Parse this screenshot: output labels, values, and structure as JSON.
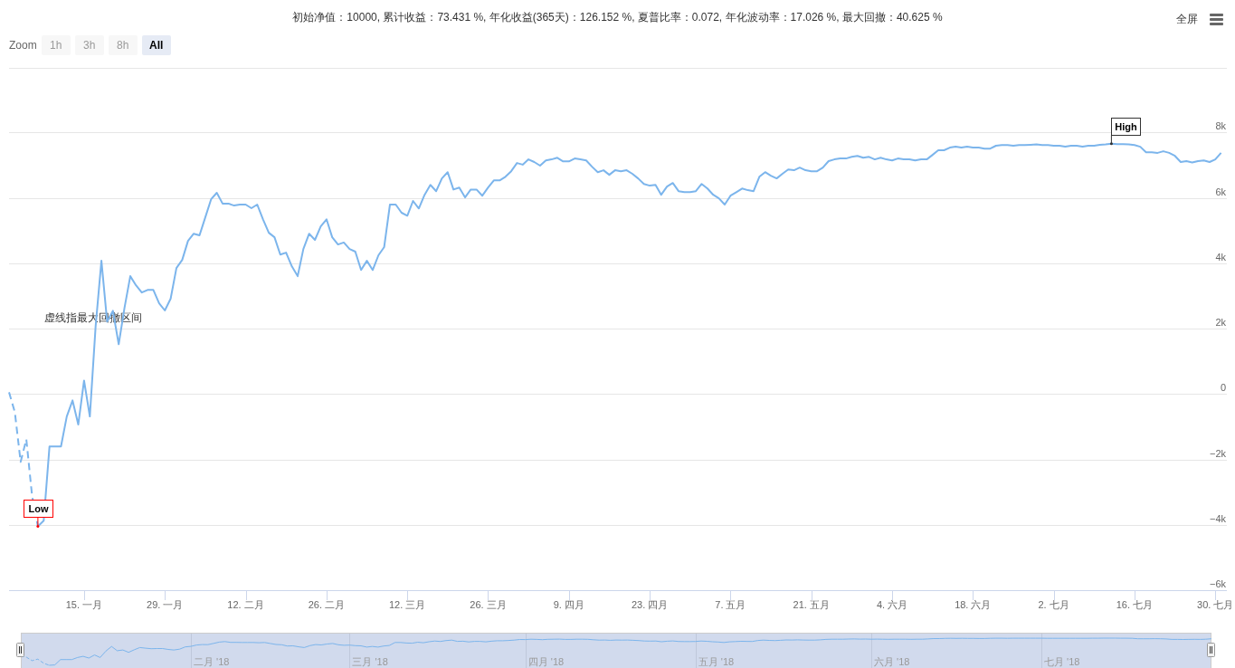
{
  "toolbar": {
    "fullscreen_label": "全屏"
  },
  "range_selector": {
    "label": "Zoom",
    "buttons": [
      {
        "label": "1h",
        "selected": false,
        "disabled": true
      },
      {
        "label": "3h",
        "selected": false,
        "disabled": true
      },
      {
        "label": "8h",
        "selected": false,
        "disabled": true
      },
      {
        "label": "All",
        "selected": true,
        "disabled": false
      }
    ]
  },
  "chart_data": {
    "type": "line",
    "title": "初始净值：10000, 累计收益：73.431 %, 年化收益(365天)：126.152 %, 夏普比率：0.072, 年化波动率：17.026 %, 最大回撤：40.625 %",
    "x": [
      "2018-01-02",
      "2018-01-03",
      "2018-01-04",
      "2018-01-05",
      "2018-01-06",
      "2018-01-07",
      "2018-01-08",
      "2018-01-09",
      "2018-01-10",
      "2018-01-11",
      "2018-01-12",
      "2018-01-13",
      "2018-01-14",
      "2018-01-15",
      "2018-01-16",
      "2018-01-17",
      "2018-01-18",
      "2018-01-19",
      "2018-01-20",
      "2018-01-21",
      "2018-01-22",
      "2018-01-23",
      "2018-01-24",
      "2018-01-25",
      "2018-01-26",
      "2018-01-27",
      "2018-01-28",
      "2018-01-29",
      "2018-01-30",
      "2018-01-31",
      "2018-02-01",
      "2018-02-02",
      "2018-02-03",
      "2018-02-04",
      "2018-02-05",
      "2018-02-06",
      "2018-02-07",
      "2018-02-08",
      "2018-02-09",
      "2018-02-10",
      "2018-02-11",
      "2018-02-12",
      "2018-02-13",
      "2018-02-14",
      "2018-02-15",
      "2018-02-16",
      "2018-02-17",
      "2018-02-18",
      "2018-02-19",
      "2018-02-20",
      "2018-02-21",
      "2018-02-22",
      "2018-02-23",
      "2018-02-24",
      "2018-02-25",
      "2018-02-26",
      "2018-02-27",
      "2018-02-28",
      "2018-03-01",
      "2018-03-02",
      "2018-03-03",
      "2018-03-04",
      "2018-03-05",
      "2018-03-06",
      "2018-03-07",
      "2018-03-08",
      "2018-03-09",
      "2018-03-10",
      "2018-03-11",
      "2018-03-12",
      "2018-03-13",
      "2018-03-14",
      "2018-03-15",
      "2018-03-16",
      "2018-03-17",
      "2018-03-18",
      "2018-03-19",
      "2018-03-20",
      "2018-03-21",
      "2018-03-22",
      "2018-03-23",
      "2018-03-24",
      "2018-03-25",
      "2018-03-26",
      "2018-03-27",
      "2018-03-28",
      "2018-03-29",
      "2018-03-30",
      "2018-03-31",
      "2018-04-01",
      "2018-04-02",
      "2018-04-03",
      "2018-04-04",
      "2018-04-05",
      "2018-04-06",
      "2018-04-07",
      "2018-04-08",
      "2018-04-09",
      "2018-04-10",
      "2018-04-11",
      "2018-04-12",
      "2018-04-13",
      "2018-04-14",
      "2018-04-15",
      "2018-04-16",
      "2018-04-17",
      "2018-04-18",
      "2018-04-19",
      "2018-04-20",
      "2018-04-21",
      "2018-04-22",
      "2018-04-23",
      "2018-04-24",
      "2018-04-25",
      "2018-04-26",
      "2018-04-27",
      "2018-04-28",
      "2018-04-29",
      "2018-04-30",
      "2018-05-01",
      "2018-05-02",
      "2018-05-03",
      "2018-05-04",
      "2018-05-05",
      "2018-05-06",
      "2018-05-07",
      "2018-05-08",
      "2018-05-09",
      "2018-05-10",
      "2018-05-11",
      "2018-05-12",
      "2018-05-13",
      "2018-05-14",
      "2018-05-15",
      "2018-05-16",
      "2018-05-17",
      "2018-05-18",
      "2018-05-19",
      "2018-05-20",
      "2018-05-21",
      "2018-05-22",
      "2018-05-23",
      "2018-05-24",
      "2018-05-25",
      "2018-05-26",
      "2018-05-27",
      "2018-05-28",
      "2018-05-29",
      "2018-05-30",
      "2018-05-31",
      "2018-06-01",
      "2018-06-02",
      "2018-06-03",
      "2018-06-04",
      "2018-06-05",
      "2018-06-06",
      "2018-06-07",
      "2018-06-08",
      "2018-06-09",
      "2018-06-10",
      "2018-06-11",
      "2018-06-12",
      "2018-06-13",
      "2018-06-14",
      "2018-06-15",
      "2018-06-16",
      "2018-06-17",
      "2018-06-18",
      "2018-06-19",
      "2018-06-20",
      "2018-06-21",
      "2018-06-22",
      "2018-06-23",
      "2018-06-24",
      "2018-06-25",
      "2018-06-26",
      "2018-06-27",
      "2018-06-28",
      "2018-06-29",
      "2018-06-30",
      "2018-07-01",
      "2018-07-02",
      "2018-07-03",
      "2018-07-04",
      "2018-07-05",
      "2018-07-06",
      "2018-07-07",
      "2018-07-08",
      "2018-07-09",
      "2018-07-10",
      "2018-07-11",
      "2018-07-12",
      "2018-07-13",
      "2018-07-14",
      "2018-07-15",
      "2018-07-16",
      "2018-07-17",
      "2018-07-18",
      "2018-07-19",
      "2018-07-20",
      "2018-07-21",
      "2018-07-22",
      "2018-07-23",
      "2018-07-24",
      "2018-07-25",
      "2018-07-26",
      "2018-07-27",
      "2018-07-28",
      "2018-07-29",
      "2018-07-30",
      "2018-07-31"
    ],
    "series": [
      {
        "color": "#7cb5ec",
        "line_style": "dashed",
        "values": [
          80,
          -530,
          -2050,
          -1360,
          -3100,
          -4020,
          null,
          null,
          null,
          null,
          null,
          null,
          null,
          null,
          null,
          null,
          null,
          null,
          null,
          null,
          null,
          null,
          null,
          null,
          null,
          null,
          null,
          null,
          null,
          null,
          null,
          null,
          null,
          null,
          null,
          null,
          null,
          null,
          null,
          null,
          null,
          null,
          null,
          null,
          null,
          null,
          null,
          null,
          null,
          null,
          null,
          null,
          null,
          null,
          null,
          null,
          null,
          null,
          null,
          null,
          null,
          null,
          null,
          null,
          null,
          null,
          null,
          null,
          null,
          null,
          null,
          null,
          null,
          null,
          null,
          null,
          null,
          null,
          null,
          null,
          null,
          null,
          null,
          null,
          null,
          null,
          null,
          null,
          null,
          null,
          null,
          null,
          null,
          null,
          null,
          null,
          null,
          null,
          null,
          null,
          null,
          null,
          null,
          null,
          null,
          null,
          null,
          null,
          null,
          null,
          null,
          null,
          null,
          null,
          null,
          null,
          null,
          null,
          null,
          null,
          null,
          null,
          null,
          null,
          null,
          null,
          null,
          null,
          null,
          null,
          null,
          null,
          null,
          null,
          null,
          null,
          null,
          null,
          null,
          null,
          null,
          null,
          null,
          null,
          null,
          null,
          null,
          null,
          null,
          null,
          null,
          null,
          null,
          null,
          null,
          null,
          null,
          null,
          null,
          null,
          null,
          null,
          null,
          null,
          null,
          null,
          null,
          null,
          null,
          null,
          null,
          null,
          null,
          null,
          null,
          null,
          null,
          null,
          null,
          null,
          null,
          null,
          null,
          null,
          null,
          null,
          null,
          null,
          null,
          null,
          null,
          null,
          null,
          null,
          null,
          null,
          null,
          null,
          null,
          null,
          null,
          null,
          null,
          null,
          null,
          null,
          null,
          null,
          null,
          null,
          null
        ]
      },
      {
        "color": "#7cb5ec",
        "line_style": "solid",
        "values": [
          null,
          null,
          null,
          null,
          null,
          -4020,
          -3850,
          -1580,
          -1580,
          -1580,
          -660,
          -170,
          -910,
          440,
          -660,
          2100,
          4100,
          2240,
          2570,
          1550,
          2660,
          3630,
          3350,
          3130,
          3210,
          3210,
          2800,
          2580,
          2940,
          3880,
          4130,
          4710,
          4930,
          4880,
          5430,
          5980,
          6180,
          5850,
          5850,
          5790,
          5820,
          5820,
          5710,
          5820,
          5370,
          4960,
          4820,
          4290,
          4350,
          3930,
          3630,
          4460,
          4930,
          4740,
          5150,
          5370,
          4820,
          4600,
          4660,
          4460,
          4380,
          3820,
          4100,
          3820,
          4270,
          4520,
          5820,
          5820,
          5570,
          5480,
          5930,
          5700,
          6120,
          6420,
          6230,
          6620,
          6810,
          6280,
          6340,
          6040,
          6280,
          6280,
          6090,
          6340,
          6560,
          6560,
          6670,
          6840,
          7090,
          7040,
          7200,
          7120,
          7010,
          7170,
          7200,
          7250,
          7140,
          7140,
          7230,
          7200,
          7170,
          6980,
          6810,
          6870,
          6730,
          6870,
          6840,
          6870,
          6760,
          6620,
          6450,
          6400,
          6420,
          6120,
          6370,
          6480,
          6230,
          6200,
          6200,
          6230,
          6450,
          6310,
          6120,
          6010,
          5820,
          6090,
          6200,
          6310,
          6260,
          6230,
          6670,
          6810,
          6700,
          6620,
          6760,
          6890,
          6870,
          6950,
          6870,
          6840,
          6840,
          6950,
          7150,
          7200,
          7230,
          7230,
          7280,
          7310,
          7250,
          7280,
          7200,
          7250,
          7200,
          7170,
          7230,
          7200,
          7200,
          7170,
          7200,
          7200,
          7340,
          7480,
          7480,
          7560,
          7590,
          7560,
          7590,
          7560,
          7560,
          7530,
          7530,
          7620,
          7640,
          7640,
          7620,
          7640,
          7640,
          7650,
          7660,
          7640,
          7640,
          7620,
          7620,
          7590,
          7620,
          7620,
          7590,
          7620,
          7620,
          7650,
          7660,
          7680,
          7670,
          7670,
          7660,
          7640,
          7590,
          7420,
          7420,
          7400,
          7450,
          7400,
          7310,
          7120,
          7150,
          7110,
          7150,
          7170,
          7120,
          7200,
          7400
        ]
      }
    ],
    "grid": true,
    "xlim": [
      "2018-01-02",
      "2018-08-01"
    ],
    "ylim": [
      -6000,
      10000
    ],
    "yticks": [
      {
        "value": -6000,
        "label": "−6k"
      },
      {
        "value": -4000,
        "label": "−4k"
      },
      {
        "value": -2000,
        "label": "−2k"
      },
      {
        "value": 0,
        "label": "0"
      },
      {
        "value": 2000,
        "label": "2k"
      },
      {
        "value": 4000,
        "label": "4k"
      },
      {
        "value": 6000,
        "label": "6k"
      },
      {
        "value": 8000,
        "label": "8k"
      }
    ],
    "xticks": [
      {
        "value": "2018-01-15",
        "label": "15. 一月"
      },
      {
        "value": "2018-01-29",
        "label": "29. 一月"
      },
      {
        "value": "2018-02-12",
        "label": "12. 二月"
      },
      {
        "value": "2018-02-26",
        "label": "26. 二月"
      },
      {
        "value": "2018-03-12",
        "label": "12. 三月"
      },
      {
        "value": "2018-03-26",
        "label": "26. 三月"
      },
      {
        "value": "2018-04-09",
        "label": "9. 四月"
      },
      {
        "value": "2018-04-23",
        "label": "23. 四月"
      },
      {
        "value": "2018-05-07",
        "label": "7. 五月"
      },
      {
        "value": "2018-05-21",
        "label": "21. 五月"
      },
      {
        "value": "2018-06-04",
        "label": "4. 六月"
      },
      {
        "value": "2018-06-18",
        "label": "18. 六月"
      },
      {
        "value": "2018-07-02",
        "label": "2. 七月"
      },
      {
        "value": "2018-07-16",
        "label": "16. 七月"
      },
      {
        "value": "2018-07-30",
        "label": "30. 七月"
      }
    ],
    "annotations": [
      "虚线指最大回撤区间",
      {
        "text": "Low",
        "x": "2018-01-07",
        "y": -4020
      },
      {
        "text": "High",
        "x": "2018-07-12",
        "y": 7680
      }
    ]
  },
  "navigator": {
    "labels": [
      "二月 '18",
      "三月 '18",
      "四月 '18",
      "五月 '18",
      "六月 '18",
      "七月 '18"
    ]
  }
}
